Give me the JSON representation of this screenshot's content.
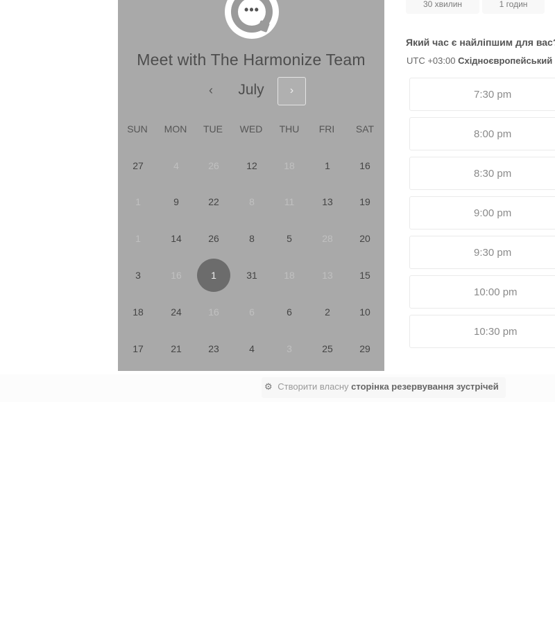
{
  "scheduler": {
    "title": "Meet with The Harmonize Team",
    "month": "July",
    "prev_label": "‹",
    "next_label": "›",
    "weekdays": [
      "SUN",
      "MON",
      "TUE",
      "WED",
      "THU",
      "FRI",
      "SAT"
    ],
    "weeks": [
      [
        {
          "d": "27",
          "off": false
        },
        {
          "d": "4",
          "off": true
        },
        {
          "d": "26",
          "off": true
        },
        {
          "d": "12",
          "off": false
        },
        {
          "d": "18",
          "off": true
        },
        {
          "d": "1",
          "off": false
        },
        {
          "d": "16",
          "off": false
        }
      ],
      [
        {
          "d": "1",
          "off": true
        },
        {
          "d": "9",
          "off": false
        },
        {
          "d": "22",
          "off": false
        },
        {
          "d": "8",
          "off": true
        },
        {
          "d": "11",
          "off": true
        },
        {
          "d": "13",
          "off": false
        },
        {
          "d": "19",
          "off": false
        }
      ],
      [
        {
          "d": "1",
          "off": true
        },
        {
          "d": "14",
          "off": false
        },
        {
          "d": "26",
          "off": false
        },
        {
          "d": "8",
          "off": false
        },
        {
          "d": "5",
          "off": false
        },
        {
          "d": "28",
          "off": true
        },
        {
          "d": "20",
          "off": false
        }
      ],
      [
        {
          "d": "3",
          "off": false
        },
        {
          "d": "16",
          "off": true
        },
        {
          "d": "1",
          "off": false,
          "selected": true
        },
        {
          "d": "31",
          "off": false
        },
        {
          "d": "18",
          "off": true
        },
        {
          "d": "13",
          "off": true
        },
        {
          "d": "15",
          "off": false
        }
      ],
      [
        {
          "d": "18",
          "off": false
        },
        {
          "d": "24",
          "off": false
        },
        {
          "d": "16",
          "off": true
        },
        {
          "d": "6",
          "off": true
        },
        {
          "d": "6",
          "off": false
        },
        {
          "d": "2",
          "off": false
        },
        {
          "d": "10",
          "off": false
        }
      ],
      [
        {
          "d": "17",
          "off": false
        },
        {
          "d": "21",
          "off": false
        },
        {
          "d": "23",
          "off": false
        },
        {
          "d": "4",
          "off": false
        },
        {
          "d": "3",
          "off": true
        },
        {
          "d": "25",
          "off": false
        },
        {
          "d": "29",
          "off": false
        }
      ]
    ]
  },
  "durations": [
    "30 хвилин",
    "1 годин"
  ],
  "question": "Який час є найліпшим для вас?",
  "timezone": {
    "offset": "UTC +03:00",
    "name": "Східноєвропейський час"
  },
  "slots": [
    "7:30 pm",
    "8:00 pm",
    "8:30 pm",
    "9:00 pm",
    "9:30 pm",
    "10:00 pm",
    "10:30 pm"
  ],
  "footer": {
    "icon": "hubspot-sprocket-icon",
    "prefix": "Створити власну",
    "link": "сторінка резервування зустрічей"
  },
  "colors": {
    "panel_bg": "#a9a9a9",
    "selected_day": "#6c6c6c"
  }
}
